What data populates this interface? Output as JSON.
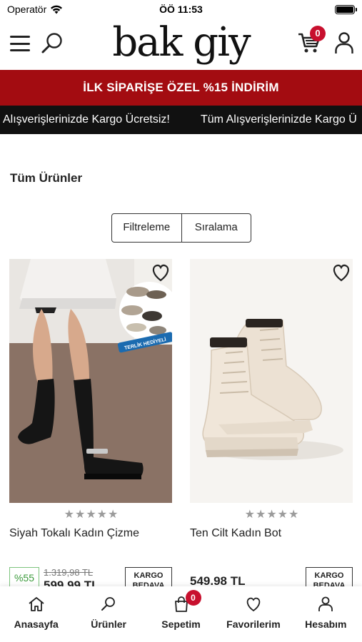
{
  "status_bar": {
    "carrier": "Operatör",
    "time": "ÖÖ 11:53"
  },
  "header": {
    "logo_text": "bak giy",
    "cart_count": "0"
  },
  "promo": {
    "text": "İLK SİPARİŞE ÖZEL %15 İNDİRİM"
  },
  "marquee": {
    "item1": "Alışverişlerinizde Kargo Ücretsiz!",
    "item2": "Tüm Alışverişlerinizde Kargo Ü"
  },
  "page": {
    "title": "Tüm Ürünler"
  },
  "controls": {
    "filter_label": "Filtreleme",
    "sort_label": "Sıralama"
  },
  "products": [
    {
      "name": "Siyah Tokalı Kadın Çizme",
      "rating_stars": "★★★★★",
      "rating_value": 0,
      "discount": "%55",
      "old_price": "1.319,98 TL",
      "new_price": "599.99 TL",
      "cargo_label": "KARGO BEDAVA",
      "image_badge": "TERLİK HEDİYELİ"
    },
    {
      "name": "Ten Cilt Kadın Bot",
      "rating_stars": "★★★★★",
      "rating_value": 0,
      "new_price": "549.98 TL",
      "cargo_label": "KARGO BEDAVA"
    }
  ],
  "bottom_nav": {
    "home": "Anasayfa",
    "products": "Ürünler",
    "cart": "Sepetim",
    "cart_count": "0",
    "favorites": "Favorilerim",
    "account": "Hesabım"
  },
  "colors": {
    "promo_bg": "#a30c11",
    "marquee_bg": "#111111",
    "badge_red": "#c8102e",
    "discount_green": "#3a9a3a"
  }
}
